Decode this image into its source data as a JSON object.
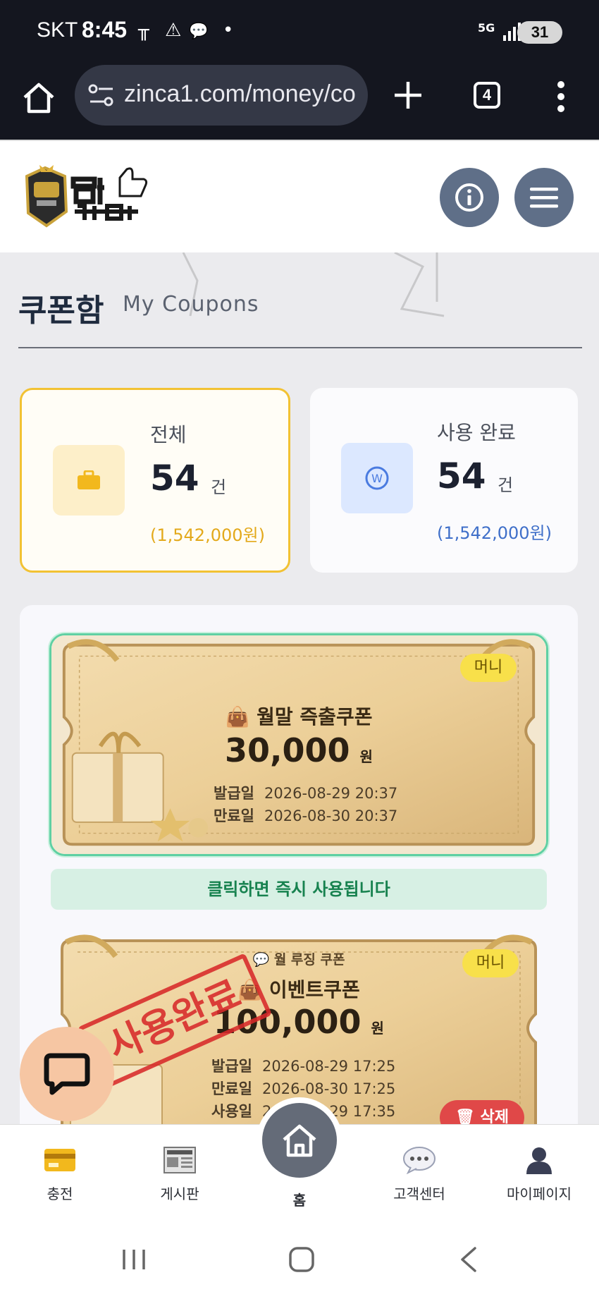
{
  "status_bar": {
    "carrier": "SKT",
    "time": "8:45",
    "network": "5G",
    "battery": "31"
  },
  "browser": {
    "url": "zinca1.com/money/co",
    "tab_count": "4"
  },
  "header": {
    "logo_alt": "찐카지노",
    "info_icon": "info-icon",
    "menu_icon": "hamburger-icon"
  },
  "page": {
    "title": "쿠폰함",
    "subtitle": "My Coupons"
  },
  "stats": {
    "all": {
      "label": "전체",
      "count": "54",
      "unit": "건",
      "amount": "(1,542,000원)",
      "color": "#f2c233"
    },
    "used": {
      "label": "사용 완료",
      "count": "54",
      "unit": "건",
      "amount": "(1,542,000원)",
      "color": "#3f6fc9"
    }
  },
  "coupons": [
    {
      "badge": "머니",
      "name": "월말 즉출쿠폰",
      "amount": "30,000",
      "currency": "원",
      "issued_label": "발급일",
      "issued": "2026-08-29 20:37",
      "expires_label": "만료일",
      "expires": "2026-08-30 20:37",
      "notice": "클릭하면 즉시 사용됩니다"
    },
    {
      "badge": "머니",
      "sub_label": "월 루징 쿠폰",
      "name": "이벤트쿠폰",
      "amount": "100,000",
      "currency": "원",
      "issued_label": "발급일",
      "issued": "2026-08-29 17:25",
      "expires_label": "만료일",
      "expires": "2026-08-30 17:25",
      "used_label": "사용일",
      "used": "2026-08-29 17:35",
      "stamp": "사용완료",
      "delete_label": "삭제"
    }
  ],
  "bottom_nav": [
    {
      "label": "충전",
      "icon": "credit-card-icon"
    },
    {
      "label": "게시판",
      "icon": "newspaper-icon"
    },
    {
      "label": "홈",
      "icon": "home-icon"
    },
    {
      "label": "고객센터",
      "icon": "chat-bubble-icon"
    },
    {
      "label": "마이페이지",
      "icon": "user-icon"
    }
  ]
}
